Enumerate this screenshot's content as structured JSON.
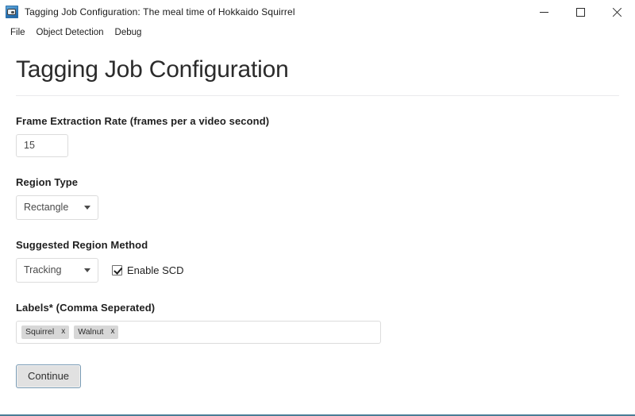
{
  "window": {
    "title": "Tagging Job Configuration: The meal time of Hokkaido Squirrel",
    "icon": "app-camera-icon",
    "controls": {
      "minimize": "minimize-icon",
      "maximize": "maximize-icon",
      "close": "close-icon"
    }
  },
  "menubar": {
    "items": [
      {
        "label": "File"
      },
      {
        "label": "Object Detection"
      },
      {
        "label": "Debug"
      }
    ]
  },
  "page": {
    "title": "Tagging Job Configuration"
  },
  "form": {
    "frame_rate": {
      "label": "Frame Extraction Rate (frames per a video second)",
      "value": "15",
      "placeholder": ""
    },
    "region_type": {
      "label": "Region Type",
      "selected": "Rectangle",
      "caret": "chevron-down-icon"
    },
    "suggested_region_method": {
      "label": "Suggested Region Method",
      "selected": "Tracking",
      "caret": "chevron-down-icon",
      "checkbox": {
        "label": "Enable SCD",
        "checked": true
      }
    },
    "labels": {
      "label": "Labels* (Comma Seperated)",
      "placeholder": "",
      "tags": [
        {
          "text": "Squirrel",
          "remove": "x"
        },
        {
          "text": "Walnut",
          "remove": "x"
        }
      ]
    },
    "submit": {
      "label": "Continue"
    }
  },
  "colors": {
    "accent_border": "#7a9cb5",
    "window_bottom": "#4a7d96",
    "tag_bg": "#d7d7d7",
    "input_border": "#dcdcdc"
  }
}
